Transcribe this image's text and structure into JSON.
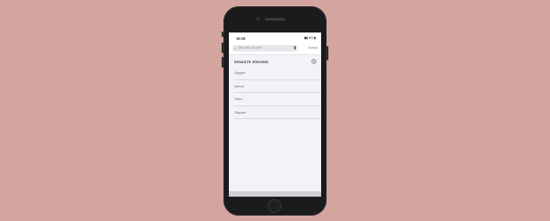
{
  "statusbar": {
    "time": "10:10",
    "indicators": "▮▮ 4G ▮"
  },
  "search": {
    "placeholder": "Sök efter du vill?",
    "cancel_label": "Avbryt"
  },
  "recent": {
    "title": "SENASTE SÖKNING",
    "clear_symbol": "×",
    "items": [
      {
        "label": "Sapper"
      },
      {
        "label": "Nervei"
      },
      {
        "label": "Vidta"
      },
      {
        "label": "Slapper"
      }
    ]
  },
  "colors": {
    "background": "#d4a49f",
    "phone": "#1b1b1d",
    "screen": "#f2f2f7"
  }
}
